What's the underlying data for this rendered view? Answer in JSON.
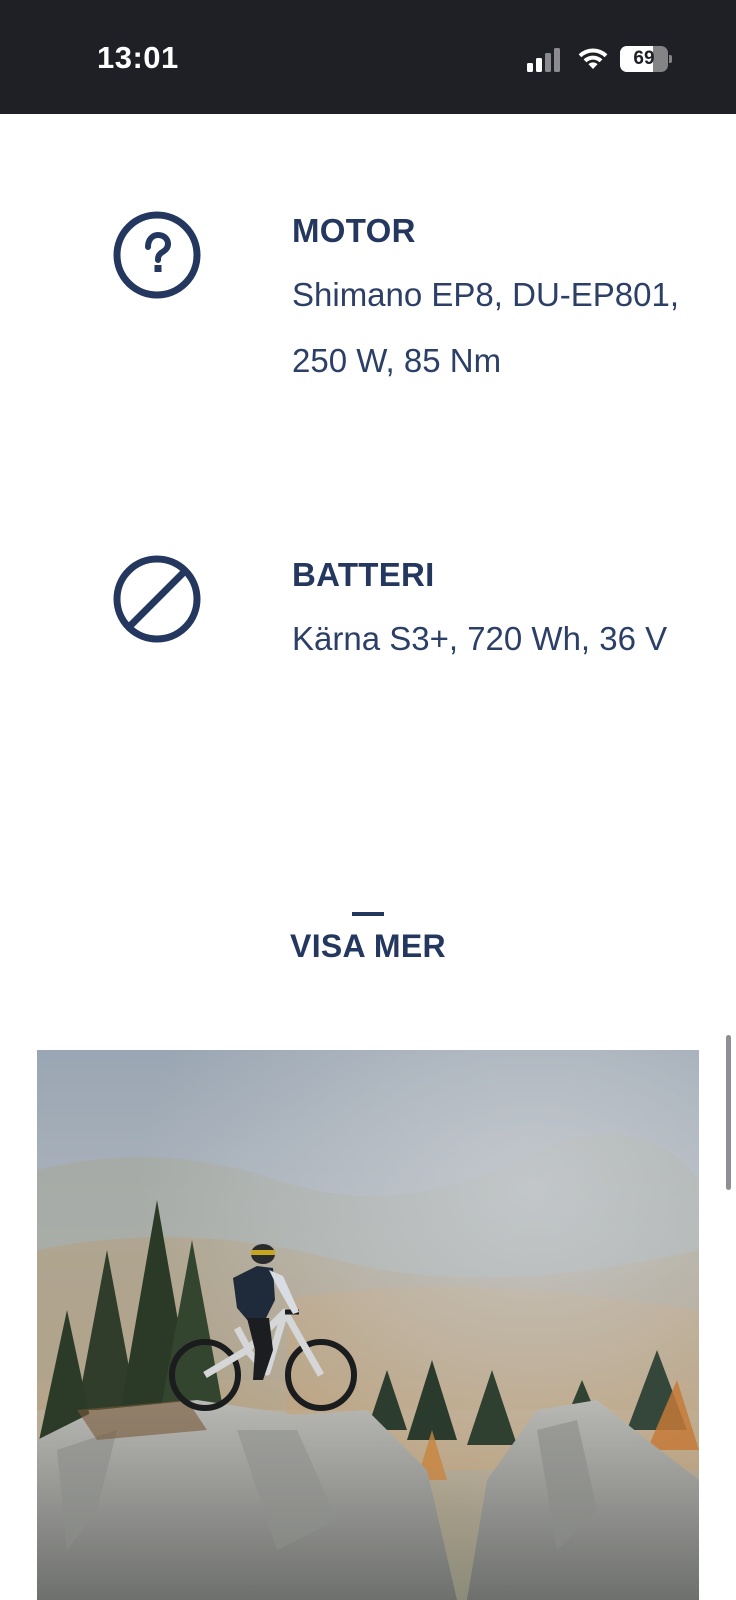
{
  "status_bar": {
    "time": "13:01",
    "battery_level": "69",
    "battery_fraction": 0.69,
    "signal_bars_active": 2,
    "icons": [
      "signal-icon",
      "wifi-icon",
      "battery-icon"
    ]
  },
  "specs": [
    {
      "title": "MOTOR",
      "value": "Shimano EP8, DU-EP801, 250 W, 85 Nm",
      "icon": "question-circle-icon"
    },
    {
      "title": "BATTERI",
      "value": "Kärna S3+, 720 Wh, 36 V",
      "icon": "prohibited-icon"
    }
  ],
  "show_more": {
    "label": "VISA MER"
  },
  "colors": {
    "accent": "#24375f",
    "status_bar_bg": "#1f2025",
    "page_bg": "#ffffff"
  },
  "hero_image": {
    "icon": "mountain-biker-photo"
  }
}
